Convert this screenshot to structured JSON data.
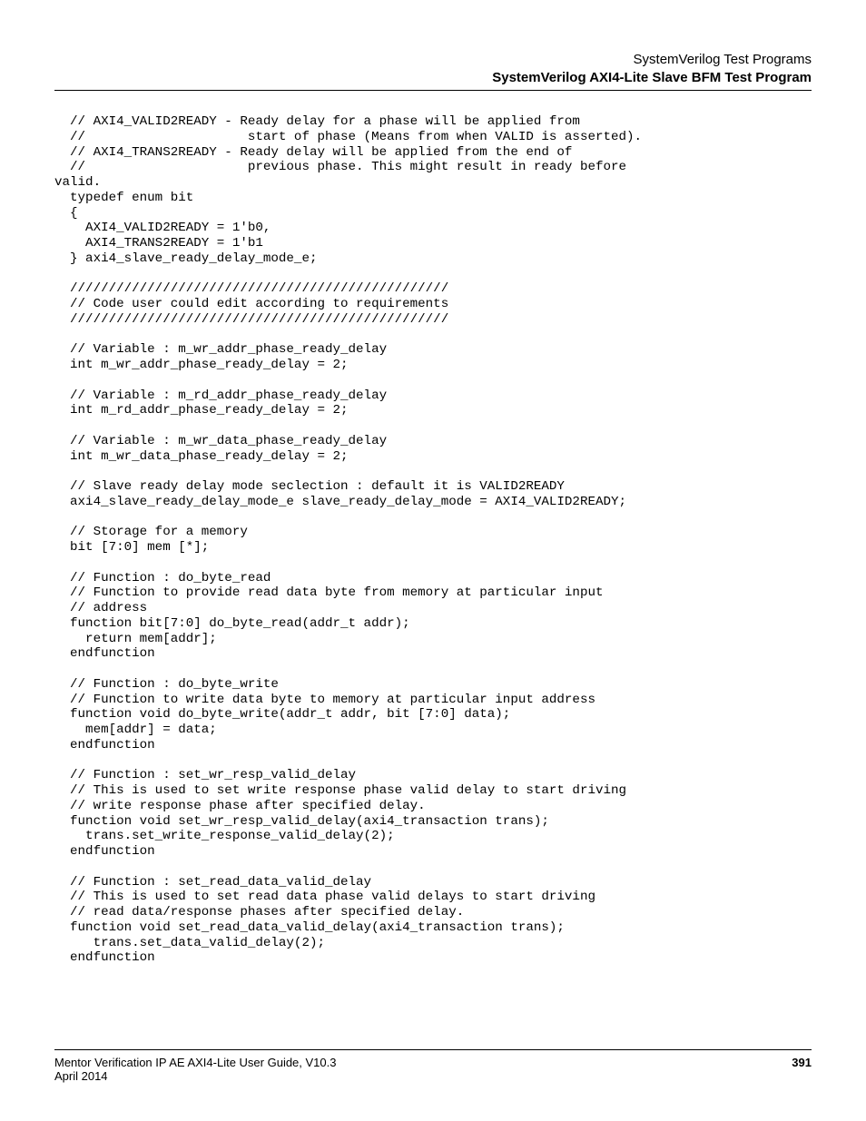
{
  "header": {
    "line1": "SystemVerilog Test Programs",
    "line2": "SystemVerilog AXI4-Lite Slave BFM Test Program"
  },
  "code": "  // AXI4_VALID2READY - Ready delay for a phase will be applied from\n  //                     start of phase (Means from when VALID is asserted).\n  // AXI4_TRANS2READY - Ready delay will be applied from the end of\n  //                     previous phase. This might result in ready before\nvalid.\n  typedef enum bit\n  {\n    AXI4_VALID2READY = 1'b0,\n    AXI4_TRANS2READY = 1'b1\n  } axi4_slave_ready_delay_mode_e;\n\n  /////////////////////////////////////////////////\n  // Code user could edit according to requirements\n  /////////////////////////////////////////////////\n\n  // Variable : m_wr_addr_phase_ready_delay\n  int m_wr_addr_phase_ready_delay = 2;\n\n  // Variable : m_rd_addr_phase_ready_delay\n  int m_rd_addr_phase_ready_delay = 2;\n\n  // Variable : m_wr_data_phase_ready_delay\n  int m_wr_data_phase_ready_delay = 2;\n\n  // Slave ready delay mode seclection : default it is VALID2READY\n  axi4_slave_ready_delay_mode_e slave_ready_delay_mode = AXI4_VALID2READY;\n\n  // Storage for a memory\n  bit [7:0] mem [*];\n\n  // Function : do_byte_read\n  // Function to provide read data byte from memory at particular input\n  // address\n  function bit[7:0] do_byte_read(addr_t addr);\n    return mem[addr];\n  endfunction\n\n  // Function : do_byte_write\n  // Function to write data byte to memory at particular input address\n  function void do_byte_write(addr_t addr, bit [7:0] data);\n    mem[addr] = data;\n  endfunction\n\n  // Function : set_wr_resp_valid_delay\n  // This is used to set write response phase valid delay to start driving\n  // write response phase after specified delay.\n  function void set_wr_resp_valid_delay(axi4_transaction trans);\n    trans.set_write_response_valid_delay(2);\n  endfunction\n\n  // Function : set_read_data_valid_delay\n  // This is used to set read data phase valid delays to start driving\n  // read data/response phases after specified delay.\n  function void set_read_data_valid_delay(axi4_transaction trans);\n     trans.set_data_valid_delay(2);\n  endfunction",
  "footer": {
    "left_line1": "Mentor Verification IP AE AXI4-Lite User Guide, V10.3",
    "left_line2": "April 2014",
    "page_number": "391"
  }
}
